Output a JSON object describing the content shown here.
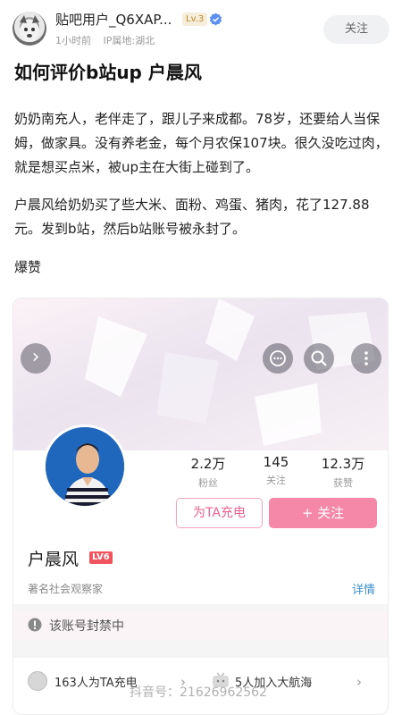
{
  "post": {
    "user_name": "贴吧用户_Q6XAP...",
    "level": "Lv.3",
    "time": "1小时前",
    "ip_location": "IP属地:湖北",
    "follow_label": "关注",
    "title": "如何评价b站up 户晨风",
    "paragraphs": [
      "奶奶南充人，老伴走了，跟儿子来成都。78岁，还要给人当保姆，做家具。没有养老金，每个月农保107块。很久没吃过肉，就是想买点米，被up主在大街上碰到了。",
      "户晨风给奶奶买了些大米、面粉、鸡蛋、猪肉，花了127.88元。发到b站，然后b站账号被永封了。",
      "爆赞"
    ]
  },
  "profile": {
    "stats": [
      {
        "value": "2.2万",
        "label": "粉丝"
      },
      {
        "value": "145",
        "label": "关注"
      },
      {
        "value": "12.3万",
        "label": "获赞"
      }
    ],
    "charge_label": "为TA充电",
    "follow_label": "+ 关注",
    "name": "户晨风",
    "lv_badge": "LV6",
    "title": "著名社会观察家",
    "detail_label": "详情",
    "ban_notice": "该账号封禁中",
    "charge_count": "163人为TA充电",
    "crew_count": "5人加入大航海",
    "chevron": "›"
  },
  "watermark": "抖音号：21626962562",
  "colors": {
    "accent_pink": "#f587a8",
    "link_blue": "#3b8fd0",
    "banned_bg": "#fbf4f7"
  }
}
